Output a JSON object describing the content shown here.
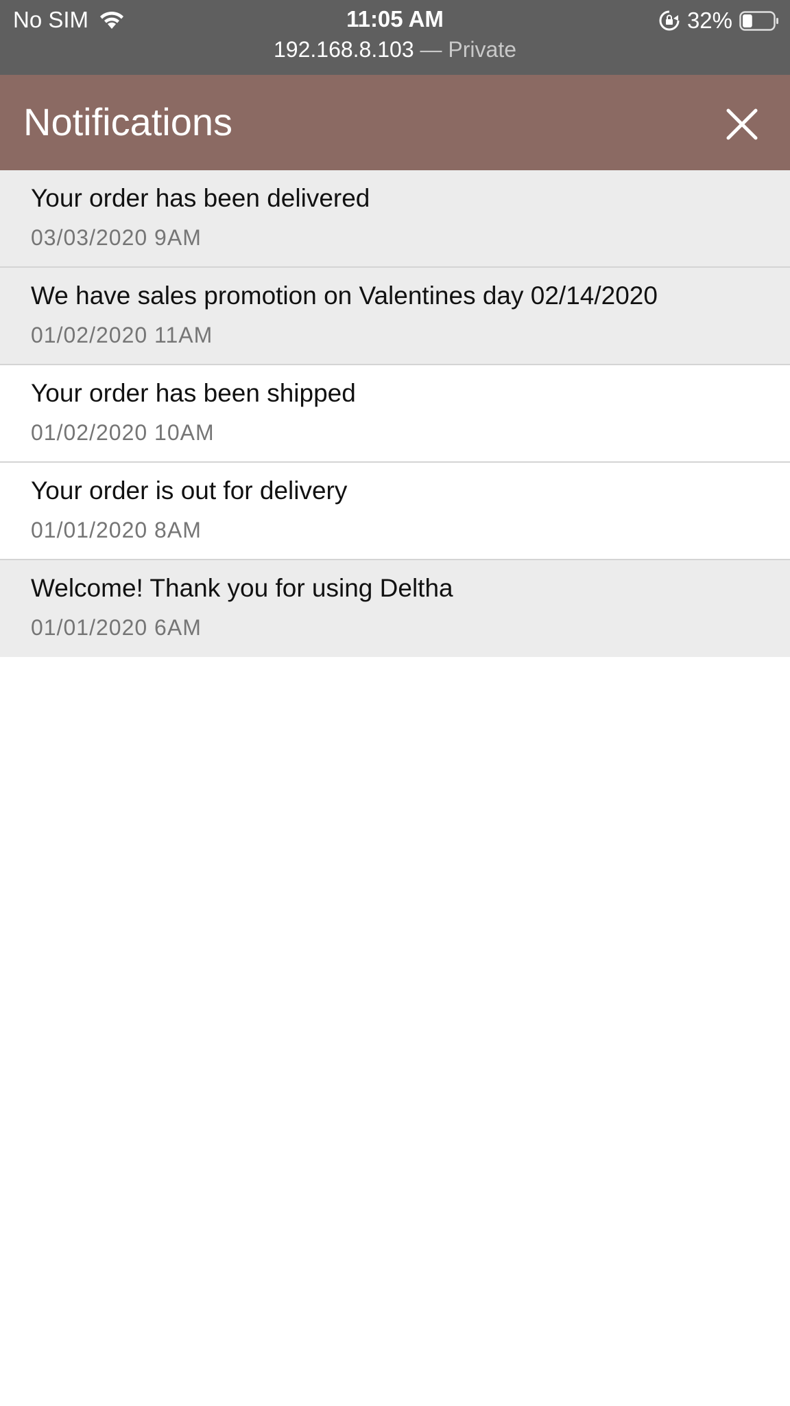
{
  "status_bar": {
    "carrier": "No SIM",
    "time": "11:05 AM",
    "url_host": "192.168.8.103",
    "url_separator": " — ",
    "url_mode": "Private",
    "battery": "32%",
    "battery_level": 0.32
  },
  "header": {
    "title": "Notifications",
    "close_icon": "close-icon",
    "background": "#8b6a63"
  },
  "notifications": [
    {
      "title": "Your order has been delivered",
      "time": "03/03/2020 9AM",
      "state": "unread"
    },
    {
      "title": "We have sales promotion on Valentines day 02/14/2020",
      "time": "01/02/2020 11AM",
      "state": "unread"
    },
    {
      "title": "Your order has been shipped",
      "time": "01/02/2020 10AM",
      "state": "read"
    },
    {
      "title": "Your order is out for delivery",
      "time": "01/01/2020 8AM",
      "state": "read"
    },
    {
      "title": "Welcome! Thank you for using Deltha",
      "time": "01/01/2020 6AM",
      "state": "unread"
    }
  ]
}
